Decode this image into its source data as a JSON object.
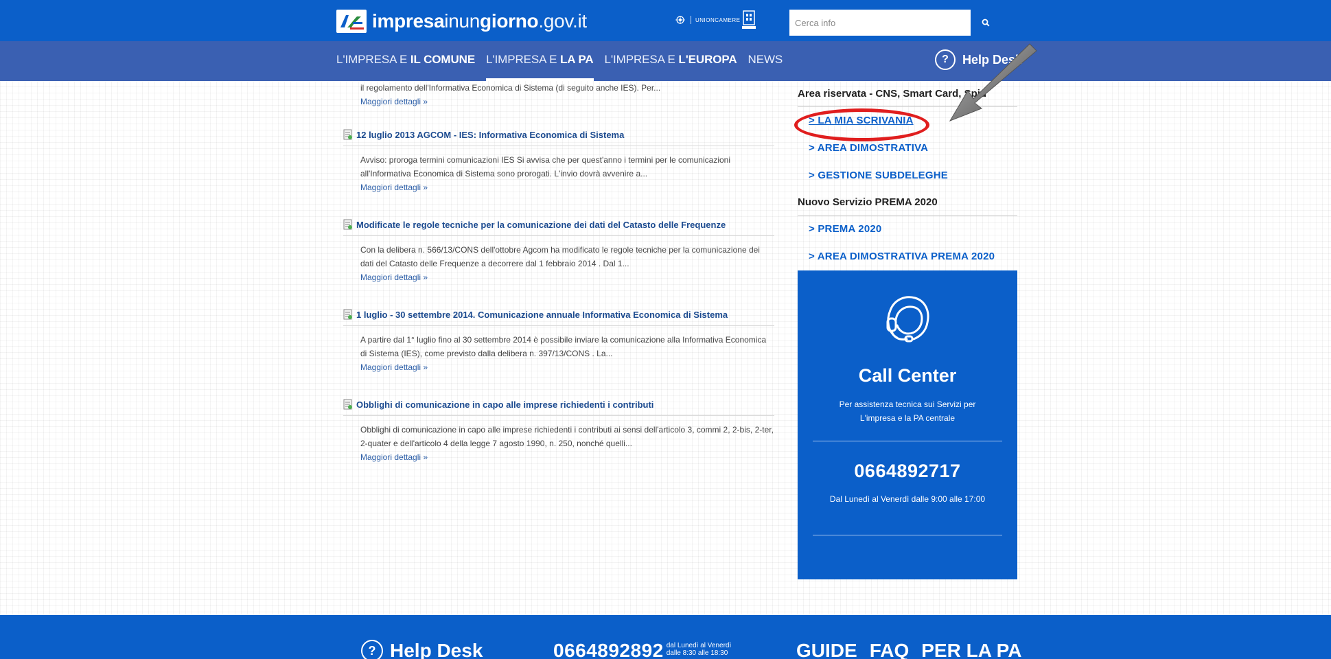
{
  "brand": {
    "logo_text_bold": "impresa",
    "logo_text_mid": "inun",
    "logo_text_bold2": "giorno",
    "logo_text_tail": ".gov.it",
    "partner": "UNIONCAMERE",
    "colors": {
      "primary": "#0b5fc9",
      "nav": "#3a60b2",
      "annotation_ring": "#e01e1e"
    }
  },
  "search": {
    "placeholder": "Cerca info",
    "icon": "search-icon"
  },
  "nav": {
    "items": [
      {
        "prefix": "L'IMPRESA E ",
        "bold": "IL COMUNE",
        "active": false
      },
      {
        "prefix": "L'IMPRESA E ",
        "bold": "LA PA",
        "active": true
      },
      {
        "prefix": "L'IMPRESA E ",
        "bold": "L'EUROPA",
        "active": false
      },
      {
        "prefix": "NEWS",
        "bold": "",
        "active": false
      }
    ],
    "help_label": "Help Desk",
    "help_icon_glyph": "?"
  },
  "news": {
    "intro_text": "il regolamento dell'Informativa Economica di Sistema (di seguito anche IES). Per...",
    "more_label": "Maggiori dettagli »",
    "items": [
      {
        "title": "12 luglio 2013 AGCOM - IES: Informativa Economica di Sistema",
        "text": "Avviso: proroga termini comunicazioni IES Si avvisa che per quest'anno i termini per le comunicazioni all'Informativa Economica di Sistema sono prorogati. L'invio dovrà avvenire a...",
        "more": "Maggiori dettagli »"
      },
      {
        "title": "Modificate le regole tecniche per la comunicazione dei dati del Catasto delle Frequenze",
        "text": "Con la delibera n. 566/13/CONS dell'ottobre Agcom ha modificato le regole tecniche per la comunicazione dei dati del Catasto delle Frequenze a decorrere dal 1 febbraio 2014 . Dal 1...",
        "more": "Maggiori dettagli »"
      },
      {
        "title": "1 luglio - 30 settembre 2014. Comunicazione annuale Informativa Economica di Sistema",
        "text": "A partire dal 1° luglio fino al 30 settembre 2014 è possibile inviare la comunicazione alla Informativa Economica di Sistema (IES), come previsto dalla delibera n. 397/13/CONS . La...",
        "more": "Maggiori dettagli »"
      },
      {
        "title": "Obblighi di comunicazione in capo alle imprese richiedenti i contributi",
        "text": "Obblighi di comunicazione in capo alle imprese richiedenti i contributi ai sensi dell'articolo 3, commi 2, 2-bis, 2-ter, 2-quater e dell'articolo 4 della legge 7 agosto 1990, n. 250, nonché quelli...",
        "more": "Maggiori dettagli »"
      }
    ]
  },
  "sidebar": {
    "reserved_heading": "Area riservata - CNS, Smart Card, Spid",
    "reserved_links": [
      "> LA MIA SCRIVANIA",
      "> AREA DIMOSTRATIVA",
      "> GESTIONE SUBDELEGHE"
    ],
    "prema_heading": "Nuovo Servizio PREMA 2020",
    "prema_links": [
      "> PREMA 2020",
      "> AREA DIMOSTRATIVA PREMA 2020"
    ],
    "call_center": {
      "title": "Call Center",
      "subtitle": "Per assistenza tecnica sui Servizi per L'impresa e la PA centrale",
      "phone": "0664892717",
      "hours": "Dal Lunedì al Venerdì dalle 9:00 alle 17:00"
    }
  },
  "footer": {
    "help_label": "Help Desk",
    "phone": "0664892892",
    "phone_hours_line1": "dal Lunedì al Venerdì",
    "phone_hours_line2": "dalle 8:30 alle 18:30",
    "links": [
      "GUIDE",
      "FAQ",
      "PER LA PA"
    ]
  }
}
